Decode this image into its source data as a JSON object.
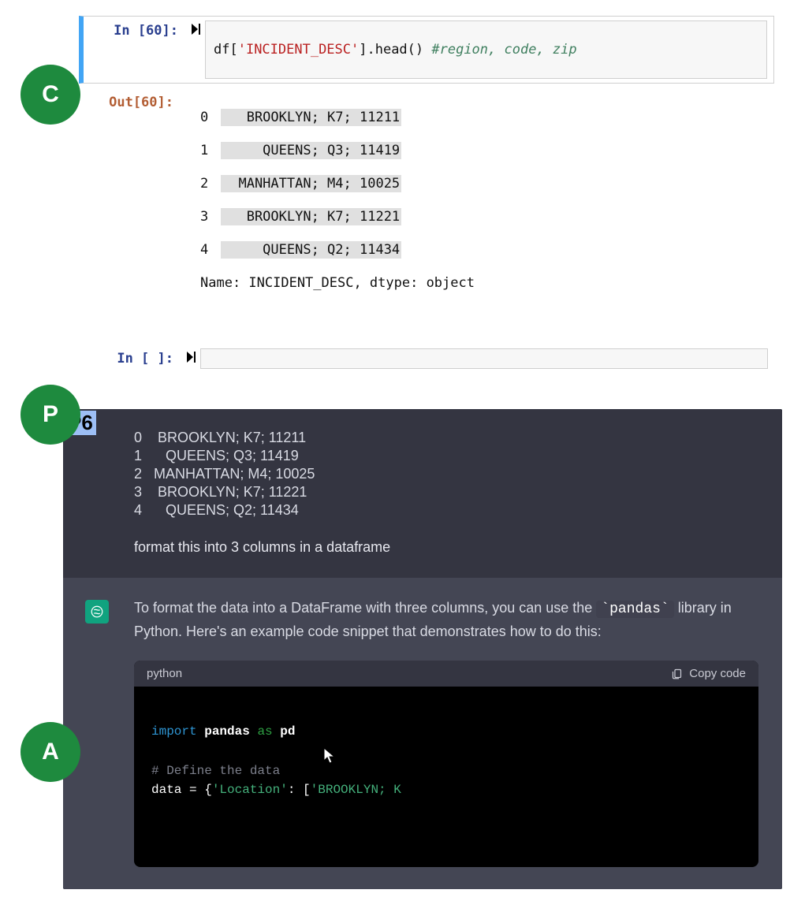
{
  "badges": {
    "c": "C",
    "p": "P",
    "a": "A",
    "p6": "P6"
  },
  "jupyter": {
    "in_prompt": "In [60]:",
    "out_prompt": "Out[60]:",
    "empty_prompt": "In [ ]:",
    "code_pre": "df[",
    "code_str": "'INCIDENT_DESC'",
    "code_post": "].head() ",
    "code_comm": "#region, code, zip",
    "out_rows": [
      {
        "i": "0",
        "v": "   BROOKLYN; K7; 11211"
      },
      {
        "i": "1",
        "v": "     QUEENS; Q3; 11419"
      },
      {
        "i": "2",
        "v": "  MANHATTAN; M4; 10025"
      },
      {
        "i": "3",
        "v": "   BROOKLYN; K7; 11221"
      },
      {
        "i": "4",
        "v": "     QUEENS; Q2; 11434"
      }
    ],
    "out_footer": "Name: INCIDENT_DESC, dtype: object"
  },
  "chat": {
    "user_rows": [
      "0    BROOKLYN; K7; 11211",
      "1      QUEENS; Q3; 11419",
      "2   MANHATTAN; M4; 10025",
      "3    BROOKLYN; K7; 11221",
      "4      QUEENS; Q2; 11434"
    ],
    "user_instruction": "format this into 3 columns in a dataframe",
    "assist_text_pre": "To format the data into a DataFrame with three columns, you can use the ",
    "assist_text_code": "`pandas`",
    "assist_text_post": " library in Python. Here's an example code snippet that demonstrates how to do this:",
    "code_lang": "python",
    "copy_label": "Copy code",
    "code": {
      "l1_kw": "import",
      "l1_mod": "pandas",
      "l1_as": "as",
      "l1_alias": "pd",
      "l3_comment": "# Define the data",
      "l4_pre": "data = {",
      "l4_key": "'Location'",
      "l4_mid": ": [",
      "l4_val": "'BROOKLYN; K"
    }
  }
}
